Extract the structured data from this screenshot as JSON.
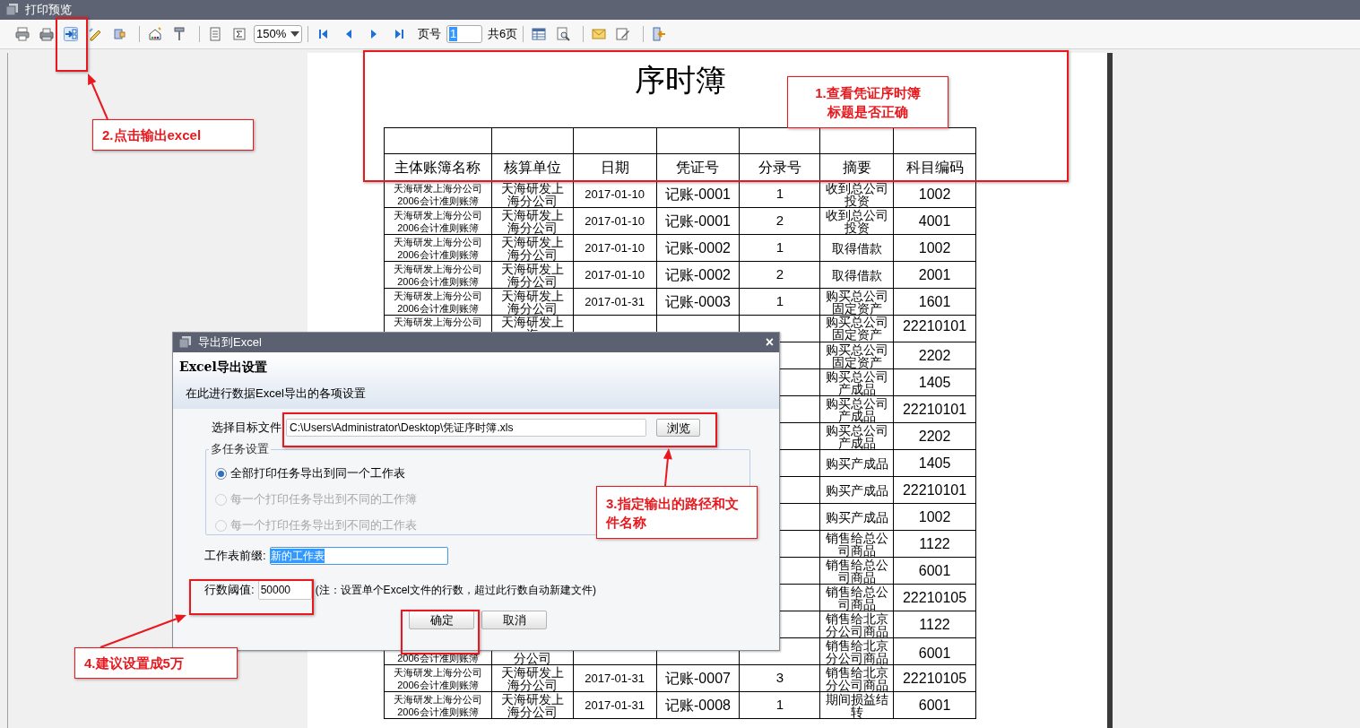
{
  "window": {
    "title": "打印预览"
  },
  "toolbar": {
    "zoom": "150%",
    "page_label": "页号",
    "page_value": "1",
    "page_total": "共6页"
  },
  "report": {
    "title": "序时簿",
    "columns": [
      "主体账簿名称",
      "核算单位",
      "日期",
      "凭证号",
      "分录号",
      "摘要",
      "科目编码"
    ],
    "rows": [
      {
        "entity": "天海研发上海分公司2006会计准则账簿",
        "unit": "天海研发上海分公司",
        "date": "2017-01-10",
        "voucher": "记账-0001",
        "entry": "1",
        "summary": "收到总公司投资",
        "code": "1002"
      },
      {
        "entity": "天海研发上海分公司2006会计准则账簿",
        "unit": "天海研发上海分公司",
        "date": "2017-01-10",
        "voucher": "记账-0001",
        "entry": "2",
        "summary": "收到总公司投资",
        "code": "4001"
      },
      {
        "entity": "天海研发上海分公司2006会计准则账簿",
        "unit": "天海研发上海分公司",
        "date": "2017-01-10",
        "voucher": "记账-0002",
        "entry": "1",
        "summary": "取得借款",
        "code": "1002"
      },
      {
        "entity": "天海研发上海分公司2006会计准则账簿",
        "unit": "天海研发上海分公司",
        "date": "2017-01-10",
        "voucher": "记账-0002",
        "entry": "2",
        "summary": "取得借款",
        "code": "2001"
      },
      {
        "entity": "天海研发上海分公司2006会计准则账簿",
        "unit": "天海研发上海分公司",
        "date": "2017-01-31",
        "voucher": "记账-0003",
        "entry": "1",
        "summary": "购买总公司固定资产",
        "code": "1601"
      },
      {
        "entity": "天海研发上海分公司",
        "unit": "天海研发上海",
        "summary": "购买总公司固定资产",
        "code": "22210101"
      },
      {
        "summary": "购买总公司固定资产",
        "code": "2202"
      },
      {
        "summary": "购买总公司产成品",
        "code": "1405"
      },
      {
        "summary": "购买总公司产成品",
        "code": "22210101"
      },
      {
        "summary": "购买总公司产成品",
        "code": "2202"
      },
      {
        "summary": "购买产成品",
        "code": "1405"
      },
      {
        "summary": "购买产成品",
        "code": "22210101"
      },
      {
        "summary": "购买产成品",
        "code": "1002"
      },
      {
        "summary": "销售给总公司商品",
        "code": "1122"
      },
      {
        "summary": "销售给总公司商品",
        "code": "6001"
      },
      {
        "summary": "销售给总公司商品",
        "code": "22210105"
      },
      {
        "summary": "销售给北京分公司商品",
        "code": "1122"
      },
      {
        "entity": "2006会计准则账簿",
        "unit": "分公司",
        "summary": "销售给北京分公司商品",
        "code": "6001"
      },
      {
        "entity": "天海研发上海分公司2006会计准则账簿",
        "unit": "天海研发上海分公司",
        "date": "2017-01-31",
        "voucher": "记账-0007",
        "entry": "3",
        "summary": "销售给北京分公司商品",
        "code": "22210105"
      },
      {
        "entity": "天海研发上海分公司2006会计准则账簿",
        "unit": "天海研发上海分公司",
        "date": "2017-01-31",
        "voucher": "记账-0008",
        "entry": "1",
        "summary": "期间损益结转",
        "code": "6001"
      }
    ]
  },
  "dialog": {
    "title": "导出到Excel",
    "close": "×",
    "heading": "Excel导出设置",
    "subtitle": "在此进行数据Excel导出的各项设置",
    "file_label": "选择目标文件",
    "file_value": "C:\\Users\\Administrator\\Desktop\\凭证序时簿.xls",
    "browse": "浏览",
    "group_title": "多任务设置",
    "options": [
      {
        "label": "全部打印任务导出到同一个工作表",
        "selected": true,
        "disabled": false
      },
      {
        "label": "每一个打印任务导出到不同的工作簿",
        "selected": false,
        "disabled": true
      },
      {
        "label": "每一个打印任务导出到不同的工作表",
        "selected": false,
        "disabled": true
      }
    ],
    "prefix_label": "工作表前缀:",
    "prefix_value": "新的工作表",
    "limit_label": "行数阈值:",
    "limit_value": "50000",
    "limit_note": "(注：设置单个Excel文件的行数，超过此行数自动新建文件)",
    "buttons": [
      "确定",
      "取消"
    ]
  },
  "annotations": [
    {
      "lines": [
        "1.查看凭证序时簿",
        "标题是否正确"
      ]
    },
    {
      "lines": [
        "2.点击输出excel"
      ]
    },
    {
      "lines": [
        "3.指定输出的路径和文",
        "件名称"
      ]
    },
    {
      "lines": [
        "4.建议设置成5万"
      ]
    }
  ]
}
